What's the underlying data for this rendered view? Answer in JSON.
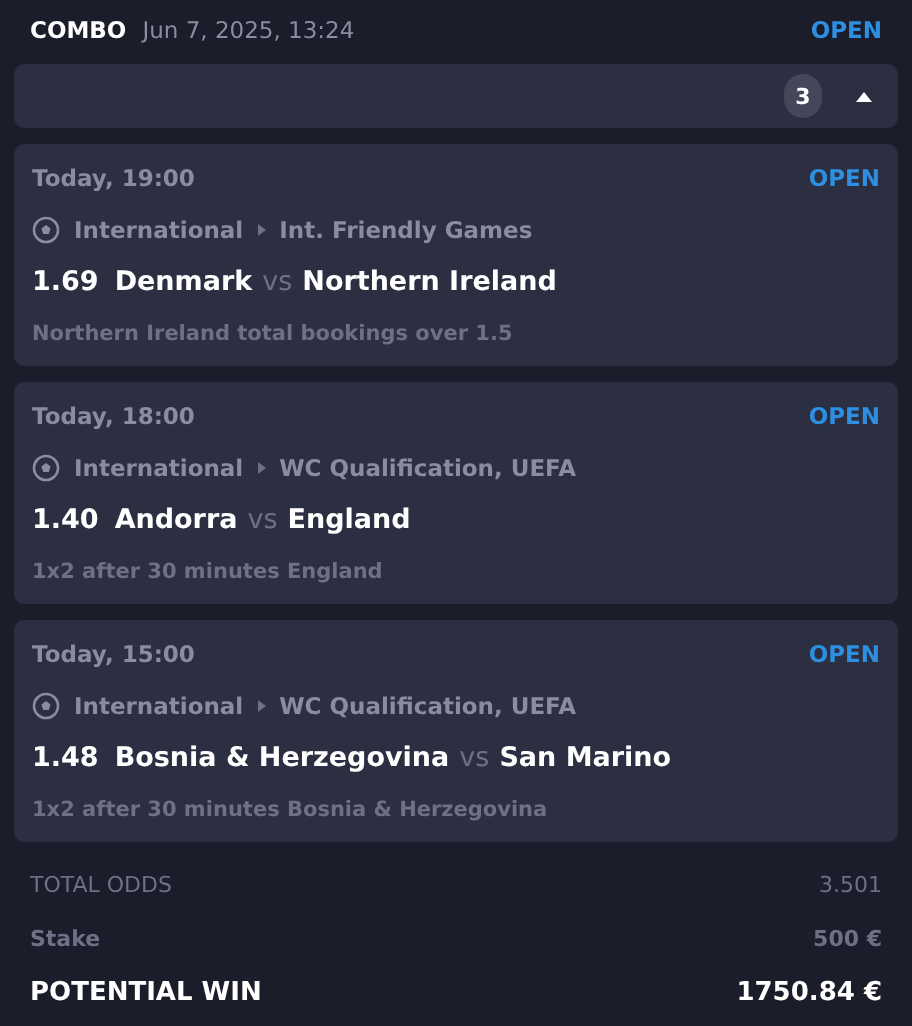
{
  "header": {
    "type": "COMBO",
    "date": "Jun 7, 2025, 13:24",
    "status": "OPEN"
  },
  "legs_bar": {
    "count": "3",
    "expanded": true
  },
  "legs": [
    {
      "time": "Today, 19:00",
      "status": "OPEN",
      "category": "International",
      "league": "Int. Friendly Games",
      "odds": "1.69",
      "home": "Denmark",
      "vs": "vs",
      "away": "Northern Ireland",
      "market": "Northern Ireland total bookings over 1.5"
    },
    {
      "time": "Today, 18:00",
      "status": "OPEN",
      "category": "International",
      "league": "WC Qualification, UEFA",
      "odds": "1.40",
      "home": "Andorra",
      "vs": "vs",
      "away": "England",
      "market": "1x2 after 30 minutes England"
    },
    {
      "time": "Today, 15:00",
      "status": "OPEN",
      "category": "International",
      "league": "WC Qualification, UEFA",
      "odds": "1.48",
      "home": "Bosnia & Herzegovina",
      "vs": "vs",
      "away": "San Marino",
      "market": "1x2 after 30 minutes Bosnia & Herzegovina"
    }
  ],
  "summary": [
    {
      "kind": "odds",
      "label": "TOTAL ODDS",
      "value": "3.501"
    },
    {
      "kind": "stake",
      "label": "Stake",
      "value": "500 €"
    },
    {
      "kind": "win",
      "label": "POTENTIAL WIN",
      "value": "1750.84 €"
    }
  ]
}
